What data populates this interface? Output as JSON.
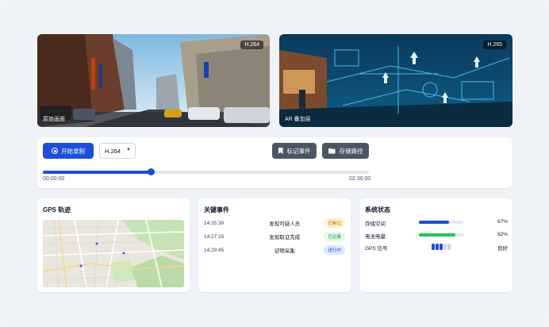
{
  "videos": [
    {
      "codec": "H.264",
      "caption": "原始画面"
    },
    {
      "codec": "H.265",
      "caption": "AR 叠加层"
    }
  ],
  "controls": {
    "record_label": "开始录制",
    "codec_selected": "H.264",
    "mark_event_label": "标记事件",
    "storage_path_label": "存储路径",
    "progress": 0.33,
    "time_start": "00:00:00",
    "time_end": "02:30:00"
  },
  "gps": {
    "title": "GPS 轨迹"
  },
  "events": {
    "title": "关键事件",
    "items": [
      {
        "time": "14:25:30",
        "desc": "发现可疑人员",
        "status": "已标记",
        "color": "yellow"
      },
      {
        "time": "14:27:15",
        "desc": "发现取证完成",
        "status": "已记录",
        "color": "green"
      },
      {
        "time": "14:29:45",
        "desc": "证物采集",
        "status": "进行中",
        "color": "blue"
      }
    ]
  },
  "status": {
    "title": "系统状态",
    "storage": {
      "label": "存储空间",
      "value": "67%",
      "fraction": 0.67,
      "color": "#1d4ed8"
    },
    "battery": {
      "label": "电池电量",
      "value": "82%",
      "fraction": 0.82,
      "color": "#22c55e"
    },
    "gps_signal": {
      "label": "GPS 信号",
      "value": "良好",
      "bars_on": 3,
      "bars_total": 5
    }
  }
}
